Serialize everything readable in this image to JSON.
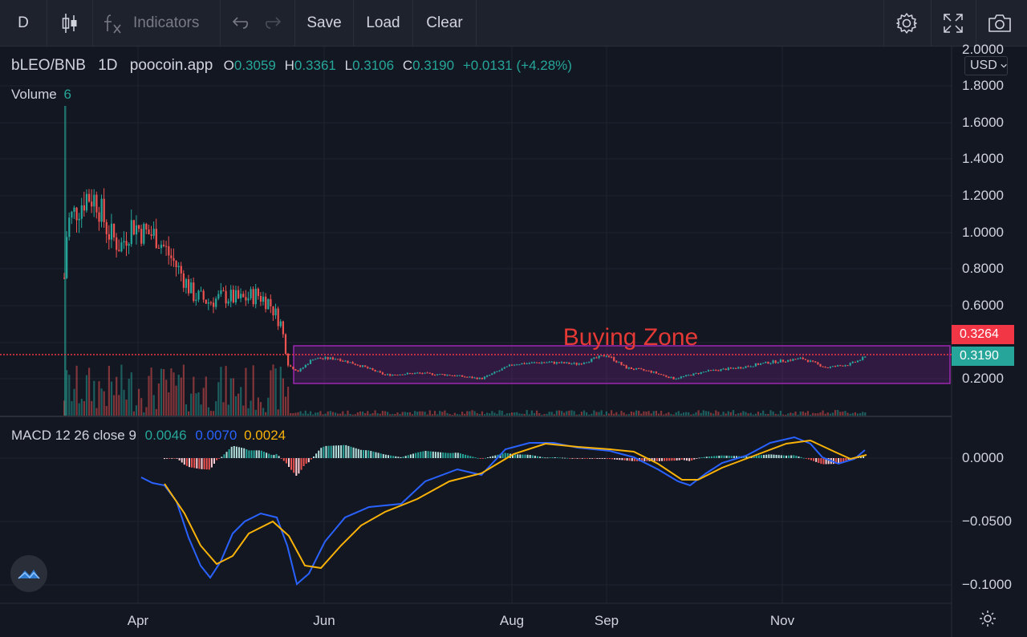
{
  "toolbar": {
    "interval": "D",
    "indicators_label": "Indicators",
    "save_label": "Save",
    "load_label": "Load",
    "clear_label": "Clear"
  },
  "legend": {
    "symbol": "bLEO/BNB",
    "interval": "1D",
    "source": "poocoin.app",
    "o_label": "O",
    "o_value": "0.3059",
    "h_label": "H",
    "h_value": "0.3361",
    "l_label": "L",
    "l_value": "0.3106",
    "c_label": "C",
    "c_value": "0.3190",
    "change": "+0.0131 (+4.28%)",
    "volume_label": "Volume",
    "volume_value": "6"
  },
  "macd_legend": {
    "label": "MACD 12 26 close 9",
    "hist": "0.0046",
    "macd": "0.0070",
    "signal": "0.0024"
  },
  "annotation": {
    "text": "Buying Zone"
  },
  "currency": "USD",
  "price_axis": [
    "2.0000",
    "1.8000",
    "1.6000",
    "1.4000",
    "1.2000",
    "1.0000",
    "0.8000",
    "0.6000",
    "0.2000"
  ],
  "macd_axis": [
    "0.0000",
    "−0.0500",
    "−0.1000"
  ],
  "time_axis": [
    "Apr",
    "Jun",
    "Aug",
    "Sep",
    "Nov"
  ],
  "price_tags": {
    "line": "0.3264",
    "last": "0.3190"
  },
  "colors": {
    "up": "#26a69a",
    "down": "#ef5350",
    "macd": "#2962ff",
    "signal": "#f9b208",
    "zone": "#9c27b0",
    "hline": "#f23645",
    "annotation": "#e53935"
  },
  "icons": [
    "candles-icon",
    "fx-icon",
    "undo-icon",
    "redo-icon",
    "settings-icon",
    "fullscreen-icon",
    "camera-icon",
    "logo-icon",
    "gear-icon"
  ]
}
